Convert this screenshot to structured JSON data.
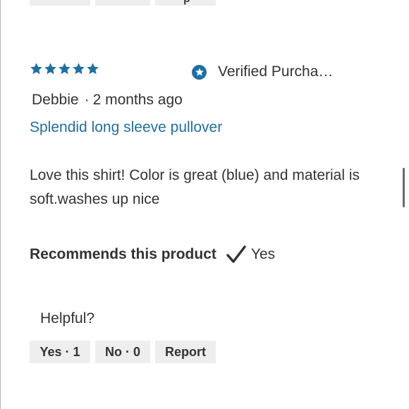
{
  "colors": {
    "accent": "#1f6fa3",
    "text": "#333333",
    "button_bg": "#eeeeee"
  },
  "top_partial": {
    "third_button_fragment": "p"
  },
  "review": {
    "rating": 5,
    "rating_max": 5,
    "verified_label": "Verified Purcha…",
    "author": "Debbie",
    "separator": "·",
    "time": "2 months ago",
    "title": "Splendid long sleeve pullover",
    "body": "Love this shirt! Color is great (blue) and material is soft.washes up nice",
    "recommend_label": "Recommends this product",
    "recommend_value": "Yes",
    "helpful_label": "Helpful?",
    "buttons": {
      "yes": "Yes · 1",
      "no": "No · 0",
      "report": "Report"
    }
  }
}
